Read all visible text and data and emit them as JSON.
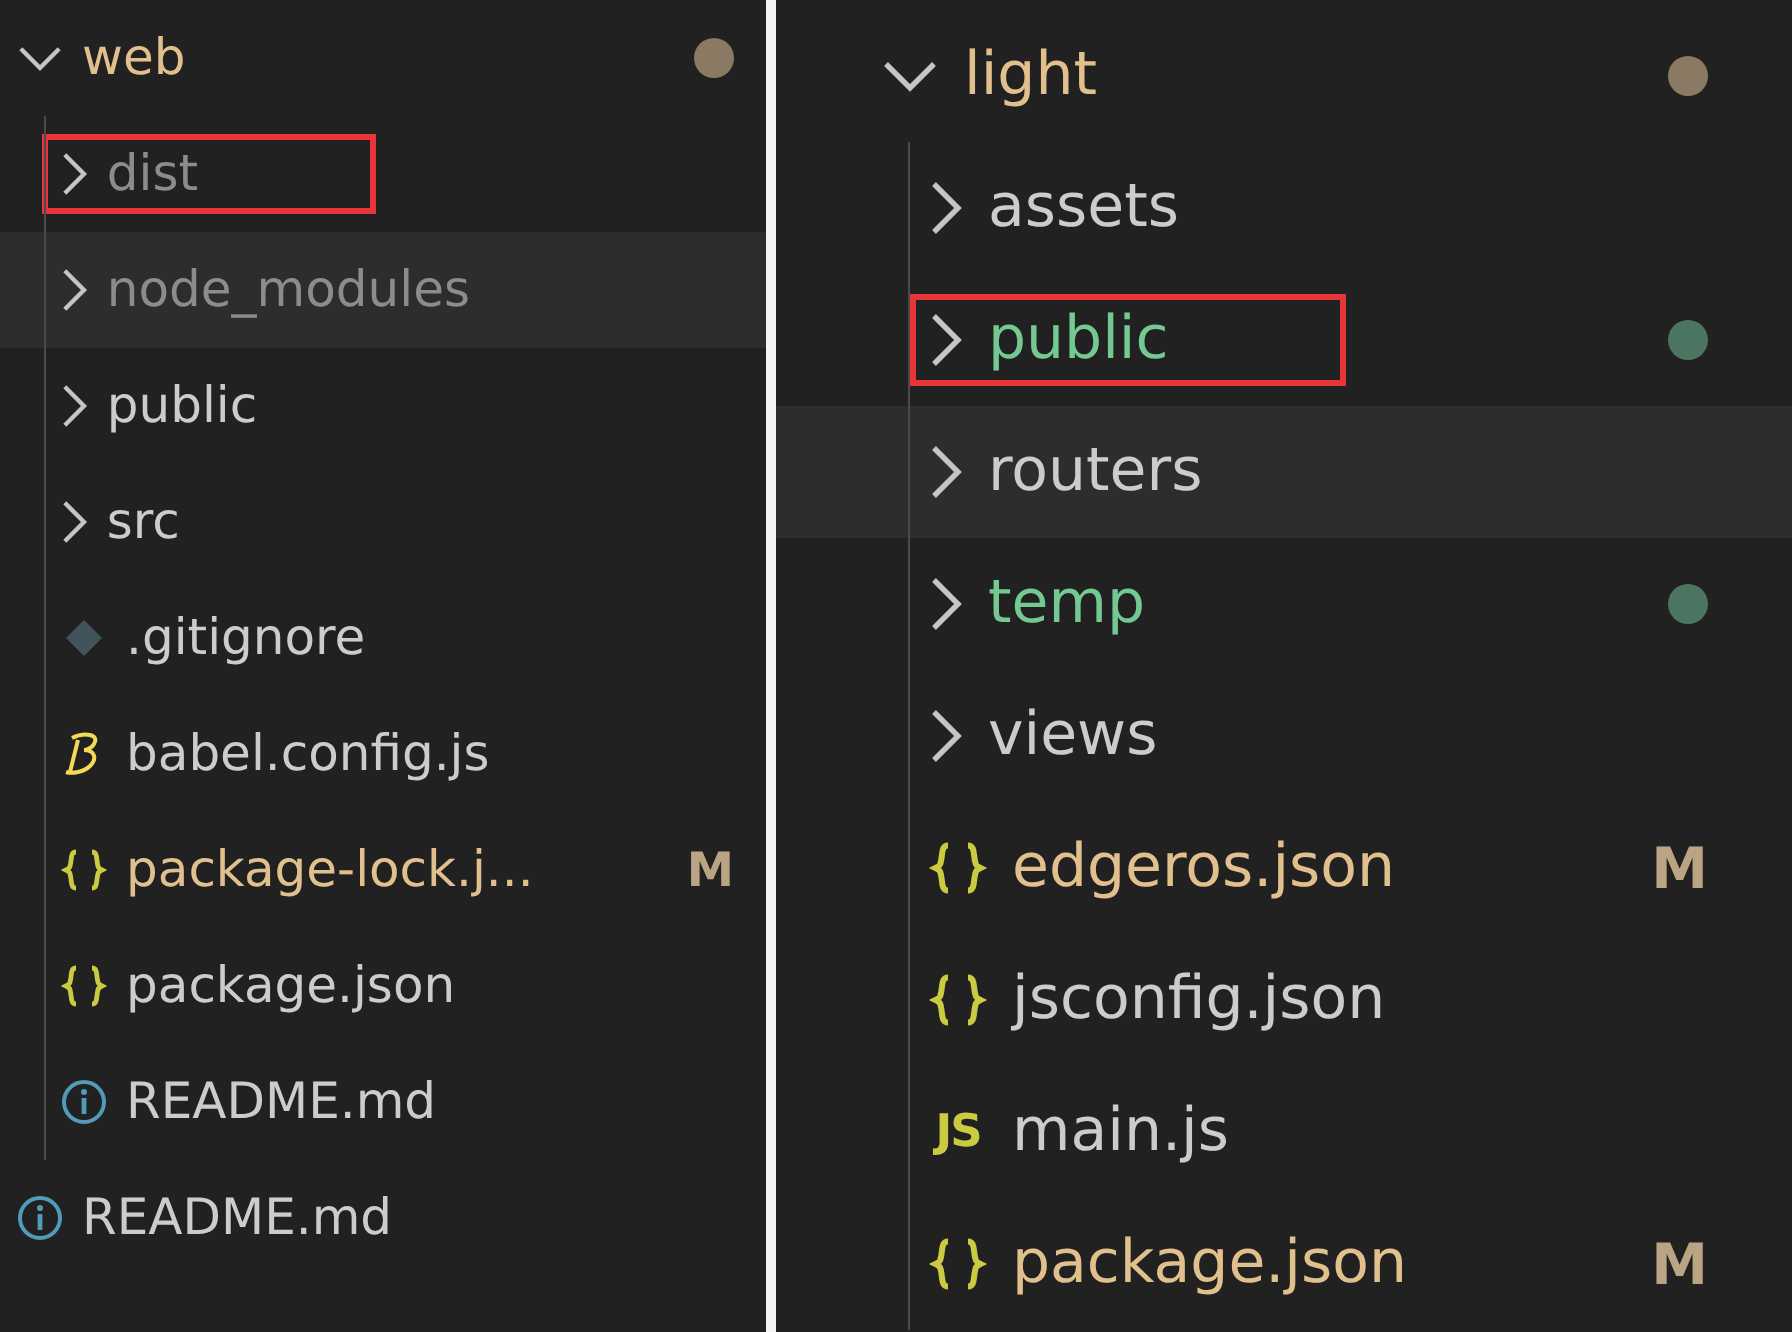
{
  "panels": [
    {
      "tree": [
        {
          "label": "web",
          "kind": "folder",
          "expanded": true,
          "modified": true,
          "untracked": false,
          "ignored": false,
          "hovered": false,
          "annotated": false,
          "children": [
            {
              "label": "dist",
              "kind": "folder",
              "expanded": false,
              "modified": false,
              "untracked": false,
              "ignored": true,
              "hovered": false,
              "annotated": true
            },
            {
              "label": "node_modules",
              "kind": "folder",
              "expanded": false,
              "modified": false,
              "untracked": false,
              "ignored": true,
              "hovered": true,
              "annotated": false
            },
            {
              "label": "public",
              "kind": "folder",
              "expanded": false,
              "modified": false,
              "untracked": false,
              "ignored": false,
              "hovered": false,
              "annotated": false
            },
            {
              "label": "src",
              "kind": "folder",
              "expanded": false,
              "modified": false,
              "untracked": false,
              "ignored": false,
              "hovered": false,
              "annotated": false
            },
            {
              "label": ".gitignore",
              "kind": "git",
              "modified": false,
              "untracked": false,
              "ignored": false,
              "hovered": false,
              "annotated": false
            },
            {
              "label": "babel.config.js",
              "kind": "babel",
              "modified": false,
              "untracked": false,
              "ignored": false,
              "hovered": false,
              "annotated": false
            },
            {
              "label": "package-lock.j...",
              "kind": "json",
              "modified": true,
              "untracked": false,
              "ignored": false,
              "badge": "M",
              "hovered": false,
              "annotated": false
            },
            {
              "label": "package.json",
              "kind": "json",
              "modified": false,
              "untracked": false,
              "ignored": false,
              "hovered": false,
              "annotated": false
            },
            {
              "label": "README.md",
              "kind": "info",
              "modified": false,
              "untracked": false,
              "ignored": false,
              "hovered": false,
              "annotated": false
            }
          ]
        },
        {
          "label": "README.md",
          "kind": "info",
          "modified": false,
          "untracked": false,
          "ignored": false,
          "hovered": false,
          "annotated": false
        }
      ]
    },
    {
      "tree": [
        {
          "label": "light",
          "kind": "folder",
          "expanded": true,
          "modified": true,
          "untracked": false,
          "ignored": false,
          "hovered": false,
          "annotated": false,
          "children": [
            {
              "label": "assets",
              "kind": "folder",
              "expanded": false,
              "modified": false,
              "untracked": false,
              "ignored": false,
              "hovered": false,
              "annotated": false
            },
            {
              "label": "public",
              "kind": "folder",
              "expanded": false,
              "modified": false,
              "untracked": true,
              "ignored": false,
              "hovered": false,
              "annotated": true
            },
            {
              "label": "routers",
              "kind": "folder",
              "expanded": false,
              "modified": false,
              "untracked": false,
              "ignored": false,
              "hovered": true,
              "annotated": false
            },
            {
              "label": "temp",
              "kind": "folder",
              "expanded": false,
              "modified": false,
              "untracked": true,
              "ignored": false,
              "hovered": false,
              "annotated": false
            },
            {
              "label": "views",
              "kind": "folder",
              "expanded": false,
              "modified": false,
              "untracked": false,
              "ignored": false,
              "hovered": false,
              "annotated": false
            },
            {
              "label": "edgeros.json",
              "kind": "json",
              "modified": true,
              "untracked": false,
              "ignored": false,
              "badge": "M",
              "hovered": false,
              "annotated": false
            },
            {
              "label": "jsconfig.json",
              "kind": "json",
              "modified": false,
              "untracked": false,
              "ignored": false,
              "hovered": false,
              "annotated": false
            },
            {
              "label": "main.js",
              "kind": "js",
              "icon_text": "JS",
              "modified": false,
              "untracked": false,
              "ignored": false,
              "hovered": false,
              "annotated": false
            },
            {
              "label": "package.json",
              "kind": "json",
              "modified": true,
              "untracked": false,
              "ignored": false,
              "badge": "M",
              "hovered": false,
              "annotated": false
            }
          ]
        }
      ]
    }
  ]
}
